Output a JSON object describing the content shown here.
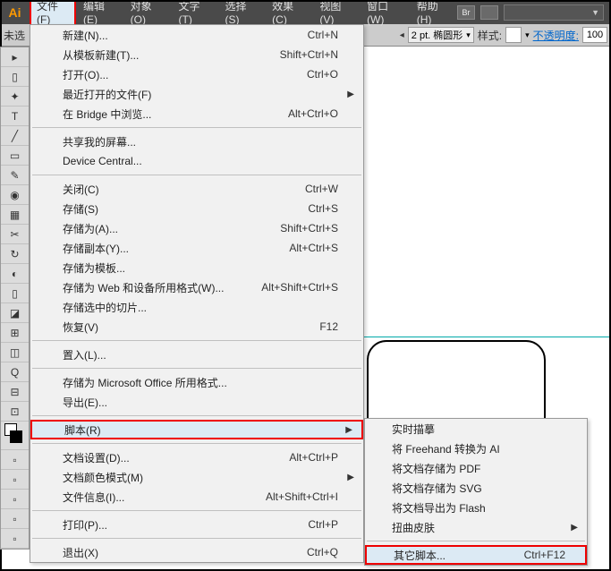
{
  "app": {
    "logo": "Ai"
  },
  "menubar": {
    "items": [
      {
        "label": "文件(F)",
        "active": true
      },
      {
        "label": "编辑(E)"
      },
      {
        "label": "对象(O)"
      },
      {
        "label": "文字(T)"
      },
      {
        "label": "选择(S)"
      },
      {
        "label": "效果(C)"
      },
      {
        "label": "视图(V)"
      },
      {
        "label": "窗口(W)"
      },
      {
        "label": "帮助(H)"
      }
    ],
    "header_right_btn": "Br"
  },
  "toolbar2": {
    "left_label": "未选",
    "stroke_value": "2 pt. 椭圆形",
    "style_label": "样式:",
    "opacity_label": "不透明度:",
    "opacity_value": "100"
  },
  "file_menu": [
    {
      "label": "新建(N)...",
      "shortcut": "Ctrl+N"
    },
    {
      "label": "从模板新建(T)...",
      "shortcut": "Shift+Ctrl+N"
    },
    {
      "label": "打开(O)...",
      "shortcut": "Ctrl+O"
    },
    {
      "label": "最近打开的文件(F)",
      "submenu": true
    },
    {
      "label": "在 Bridge 中浏览...",
      "shortcut": "Alt+Ctrl+O"
    },
    {
      "sep": true
    },
    {
      "label": "共享我的屏幕..."
    },
    {
      "label": "Device Central..."
    },
    {
      "sep": true
    },
    {
      "label": "关闭(C)",
      "shortcut": "Ctrl+W"
    },
    {
      "label": "存储(S)",
      "shortcut": "Ctrl+S"
    },
    {
      "label": "存储为(A)...",
      "shortcut": "Shift+Ctrl+S"
    },
    {
      "label": "存储副本(Y)...",
      "shortcut": "Alt+Ctrl+S"
    },
    {
      "label": "存储为模板..."
    },
    {
      "label": "存储为 Web 和设备所用格式(W)...",
      "shortcut": "Alt+Shift+Ctrl+S"
    },
    {
      "label": "存储选中的切片..."
    },
    {
      "label": "恢复(V)",
      "shortcut": "F12"
    },
    {
      "sep": true
    },
    {
      "label": "置入(L)..."
    },
    {
      "sep": true
    },
    {
      "label": "存储为 Microsoft Office 所用格式..."
    },
    {
      "label": "导出(E)..."
    },
    {
      "sep": true
    },
    {
      "label": "脚本(R)",
      "submenu": true,
      "highlight": true
    },
    {
      "sep": true
    },
    {
      "label": "文档设置(D)...",
      "shortcut": "Alt+Ctrl+P"
    },
    {
      "label": "文档颜色模式(M)",
      "submenu": true
    },
    {
      "label": "文件信息(I)...",
      "shortcut": "Alt+Shift+Ctrl+I"
    },
    {
      "sep": true
    },
    {
      "label": "打印(P)...",
      "shortcut": "Ctrl+P"
    },
    {
      "sep": true
    },
    {
      "label": "退出(X)",
      "shortcut": "Ctrl+Q"
    }
  ],
  "scripts_submenu": [
    {
      "label": "实时描摹"
    },
    {
      "label": "将 Freehand 转换为 AI"
    },
    {
      "label": "将文档存储为 PDF"
    },
    {
      "label": "将文档存储为 SVG"
    },
    {
      "label": "将文档导出为 Flash"
    },
    {
      "label": "扭曲皮肤",
      "submenu": true
    },
    {
      "sep": true
    },
    {
      "label": "其它脚本...",
      "shortcut": "Ctrl+F12",
      "highlight": true
    }
  ],
  "toolbox_glyphs": [
    "▸",
    "▯",
    "✦",
    "T",
    "╱",
    "▭",
    "✎",
    "◉",
    "▦",
    "✂",
    "↻",
    "◐",
    "▯",
    "◪",
    "⊞",
    "◫",
    "Q",
    "⊟",
    "⊡"
  ]
}
